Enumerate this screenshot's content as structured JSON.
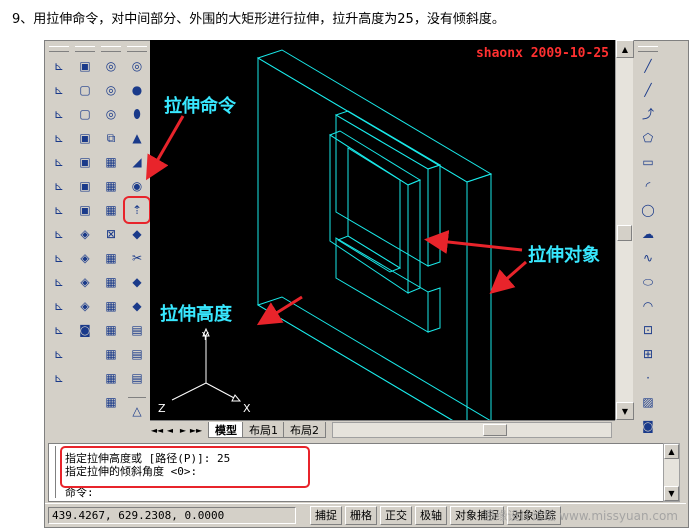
{
  "caption": "9、用拉伸命令，对中间部分、外围的大矩形进行拉伸，拉升高度为25，没有倾斜度。",
  "viewport": {
    "watermark": "shaonx 2009-10-25",
    "annotations": {
      "extrude_command": "拉伸命令",
      "extrude_height": "拉伸高度",
      "extrude_object": "拉伸对象"
    },
    "ucs": {
      "x_label": "X",
      "y_label": "Y",
      "z_label": "Z"
    }
  },
  "layout_tabs": {
    "nav": [
      "◄◄",
      "◄",
      "►",
      "►►"
    ],
    "tabs": [
      "模型",
      "布局1",
      "布局2"
    ]
  },
  "command_window": {
    "line1": "指定拉伸高度或 [路径(P)]: 25",
    "line2": "指定拉伸的倾斜角度 <0>:",
    "prompt": "命令:"
  },
  "status_bar": {
    "coordinates": "439.4267, 629.2308, 0.0000",
    "buttons": [
      "捕捉",
      "栅格",
      "正交",
      "极轴",
      "对象捕捉",
      "对象追踪"
    ],
    "site_watermark": "思缘设计论坛 www.missyuan.com"
  },
  "colors": {
    "wireframe": "#19e8e8",
    "annotation": "#38e8ff",
    "arrow": "#e8242b"
  }
}
